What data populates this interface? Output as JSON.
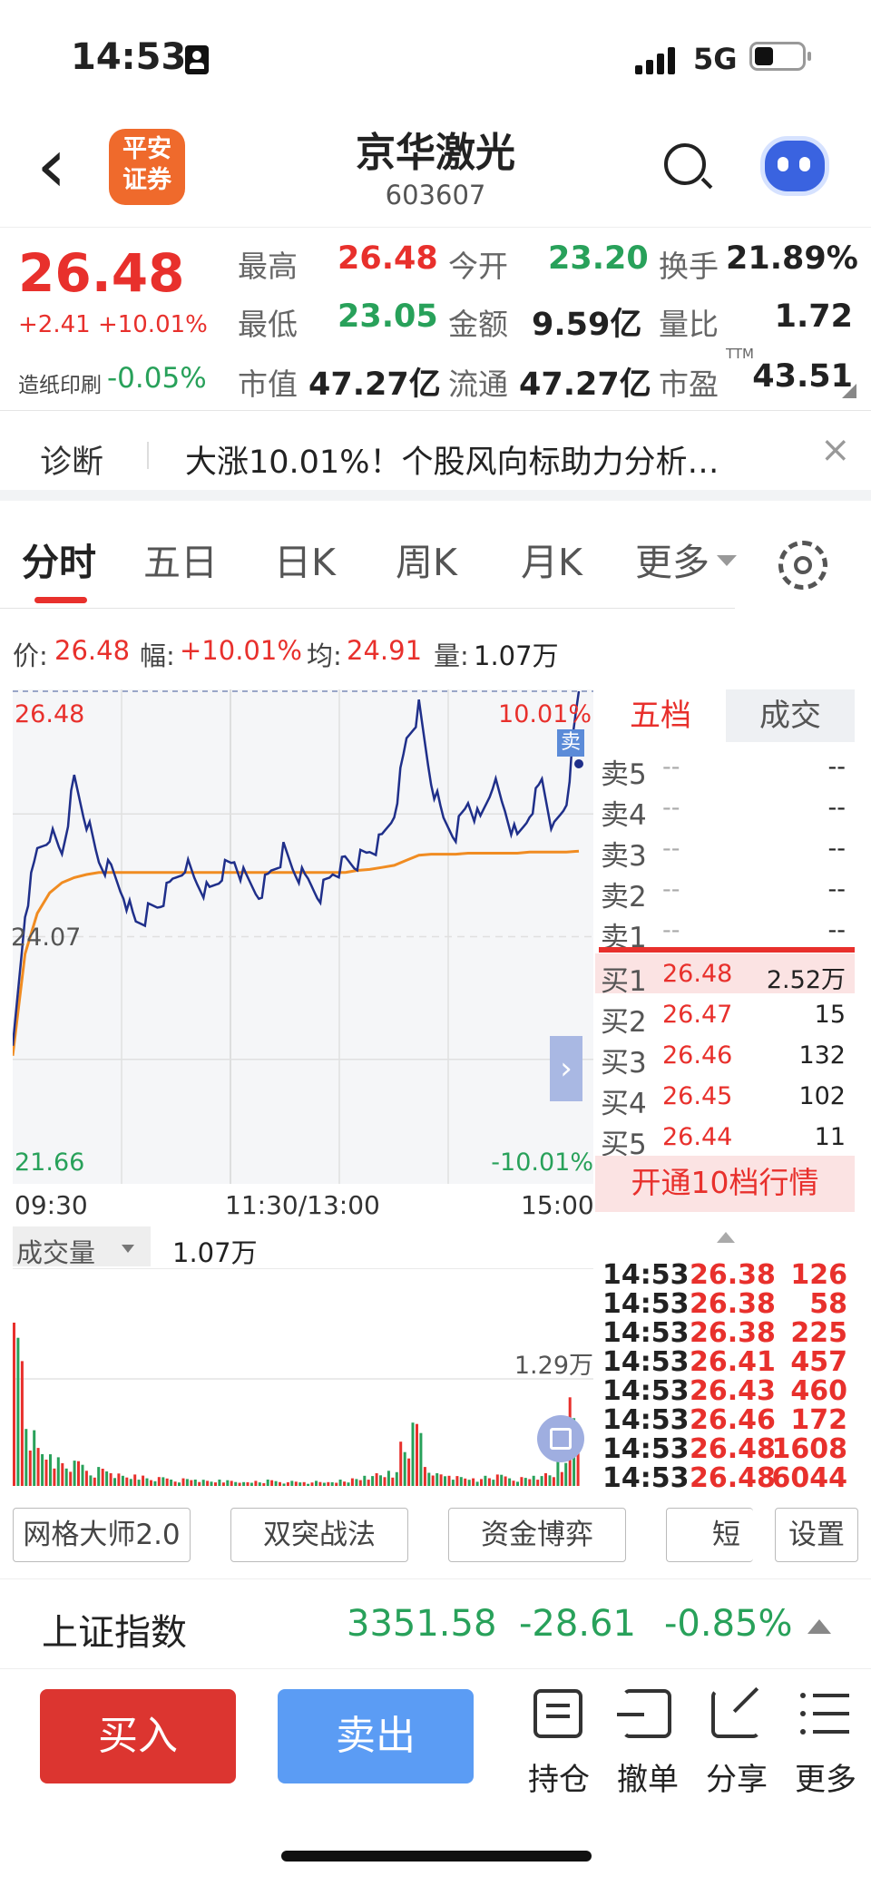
{
  "status_bar": {
    "time": "14:53",
    "network": "5G"
  },
  "nav": {
    "back": "‹",
    "logo_line1": "平安",
    "logo_line2": "证券",
    "title": "京华激光",
    "code": "603607"
  },
  "quote": {
    "price": "26.48",
    "change": "+2.41 +10.01%",
    "sector_label": "造纸印刷",
    "sector_change": "-0.05%",
    "high_label": "最高",
    "high": "26.48",
    "open_label": "今开",
    "open": "23.20",
    "turnover_label": "换手",
    "turnover": "21.89%",
    "low_label": "最低",
    "low": "23.05",
    "amount_label": "金额",
    "amount": "9.59亿",
    "vol_ratio_label": "量比",
    "vol_ratio": "1.72",
    "mktcap_label": "市值",
    "mktcap": "47.27亿",
    "float_label": "流通",
    "float": "47.27亿",
    "pe_label": "市盈",
    "pe_sup": "TTM",
    "pe": "43.51"
  },
  "diagnosis": {
    "label": "诊断",
    "text": "大涨10.01%！个股风向标助力分析…",
    "close": "×"
  },
  "tabs": {
    "items": [
      "分时",
      "五日",
      "日K",
      "周K",
      "月K",
      "更多"
    ],
    "active": 0
  },
  "price_bar": {
    "price_label": "价:",
    "price": "26.48",
    "range_label": "幅:",
    "range": "+10.01%",
    "avg_label": "均:",
    "avg": "24.91",
    "vol_label": "量:",
    "vol": "1.07万"
  },
  "chart_data": {
    "type": "line",
    "y_top": "26.48",
    "y_mid": "24.07",
    "y_bottom": "21.66",
    "pct_top": "10.01%",
    "pct_bottom": "-10.01%",
    "x_labels": [
      "09:30",
      "11:30/13:00",
      "15:00"
    ],
    "ylim": [
      21.66,
      26.48
    ],
    "sell_marker": "卖",
    "series": [],
    "price_series": [
      22.9,
      24.3,
      24.9,
      25.1,
      24.9,
      25.6,
      25.2,
      24.8,
      24.7,
      24.5,
      24.2,
      24.3,
      24.4,
      24.6,
      24.8,
      24.6,
      24.5,
      24.7,
      24.8,
      24.6,
      24.5,
      24.7,
      24.9,
      24.7,
      24.6,
      24.5,
      24.7,
      24.8,
      24.8,
      24.9,
      25.0,
      25.3,
      26.0,
      26.3,
      25.6,
      25.2,
      25.1,
      25.4,
      25.2,
      25.6,
      25.3,
      25.0,
      25.3,
      25.6,
      25.1,
      25.4,
      26.48
    ],
    "avg_series": [
      22.9,
      23.9,
      24.3,
      24.5,
      24.6,
      24.65,
      24.68,
      24.7,
      24.7,
      24.7,
      24.7,
      24.7,
      24.7,
      24.7,
      24.7,
      24.7,
      24.7,
      24.7,
      24.7,
      24.7,
      24.7,
      24.7,
      24.7,
      24.7,
      24.7,
      24.7,
      24.7,
      24.7,
      24.72,
      24.73,
      24.75,
      24.77,
      24.82,
      24.87,
      24.88,
      24.88,
      24.88,
      24.89,
      24.89,
      24.89,
      24.89,
      24.89,
      24.9,
      24.9,
      24.9,
      24.9,
      24.91
    ],
    "volume_label": "成交量",
    "volume_value": "1.07万",
    "volume_max": "1.29万",
    "volume_bars": [
      1.29,
      0.45,
      0.3,
      0.25,
      0.18,
      0.2,
      0.12,
      0.15,
      0.1,
      0.08,
      0.09,
      0.06,
      0.07,
      0.05,
      0.06,
      0.05,
      0.04,
      0.05,
      0.04,
      0.03,
      0.04,
      0.05,
      0.03,
      0.04,
      0.03,
      0.04,
      0.03,
      0.05,
      0.06,
      0.08,
      0.1,
      0.12,
      0.35,
      0.5,
      0.15,
      0.1,
      0.08,
      0.07,
      0.06,
      0.08,
      0.09,
      0.06,
      0.07,
      0.08,
      0.1,
      0.2,
      0.7
    ]
  },
  "order_book": {
    "tab_five": "五档",
    "tab_trades": "成交",
    "asks": [
      {
        "label": "卖5",
        "price": "--",
        "vol": "--"
      },
      {
        "label": "卖4",
        "price": "--",
        "vol": "--"
      },
      {
        "label": "卖3",
        "price": "--",
        "vol": "--"
      },
      {
        "label": "卖2",
        "price": "--",
        "vol": "--"
      },
      {
        "label": "卖1",
        "price": "--",
        "vol": "--"
      }
    ],
    "bids": [
      {
        "label": "买1",
        "price": "26.48",
        "vol": "2.52万"
      },
      {
        "label": "买2",
        "price": "26.47",
        "vol": "15"
      },
      {
        "label": "买3",
        "price": "26.46",
        "vol": "132"
      },
      {
        "label": "买4",
        "price": "26.45",
        "vol": "102"
      },
      {
        "label": "买5",
        "price": "26.44",
        "vol": "11"
      }
    ],
    "upgrade": "开通10档行情",
    "trades": [
      {
        "time": "14:53",
        "price": "26.38",
        "vol": "126"
      },
      {
        "time": "14:53",
        "price": "26.38",
        "vol": "58"
      },
      {
        "time": "14:53",
        "price": "26.38",
        "vol": "225"
      },
      {
        "time": "14:53",
        "price": "26.41",
        "vol": "457"
      },
      {
        "time": "14:53",
        "price": "26.43",
        "vol": "460"
      },
      {
        "time": "14:53",
        "price": "26.46",
        "vol": "172"
      },
      {
        "time": "14:53",
        "price": "26.48",
        "vol": "1608"
      },
      {
        "time": "14:53",
        "price": "26.48",
        "vol": "6044"
      }
    ]
  },
  "tools": {
    "grid": "网格大师2.0",
    "double": "双突战法",
    "fund": "资金博弈",
    "short": "短线",
    "settings": "设置"
  },
  "index": {
    "name": "上证指数",
    "value": "3351.58",
    "change": "-28.61",
    "pct": "-0.85%"
  },
  "bottom": {
    "buy": "买入",
    "sell": "卖出",
    "position": "持仓",
    "cancel": "撤单",
    "share": "分享",
    "more": "更多"
  },
  "colors": {
    "up": "#e8302c",
    "down": "#28a15a",
    "line": "#1f2f8a",
    "avg": "#f08c22",
    "buy_btn": "#dc3530",
    "sell_btn": "#5b9cf4"
  }
}
